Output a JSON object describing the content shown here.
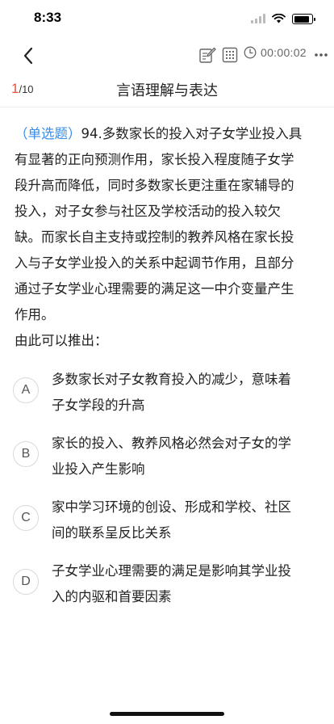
{
  "status_bar": {
    "time": "8:33"
  },
  "toolbar": {
    "timer": "00:00:02"
  },
  "subheader": {
    "progress_current": "1",
    "progress_total": "/10",
    "title": "言语理解与表达"
  },
  "question": {
    "type": "（单选题）",
    "lines": [
      "94.多数家长的投入对子女学业投入具",
      "有显著的正向预测作用，家长投入程度随子女学",
      "段升高而降低，同时多数家长更注重在家辅导的",
      "投入，对子女参与社区及学校活动的投入较欠",
      "缺。而家长自主支持或控制的教养风格在家长投",
      "入与子女学业投入的关系中起调节作用，且部分",
      "通过子女学业心理需要的满足这一中介变量产生",
      "作用。"
    ],
    "prompt": "由此可以推出："
  },
  "options": [
    {
      "letter": "A",
      "lines": [
        "多数家长对子女教育投入的减少，意味着",
        "子女学段的升高"
      ]
    },
    {
      "letter": "B",
      "lines": [
        "家长的投入、教养风格必然会对子女的学",
        "业投入产生影响"
      ]
    },
    {
      "letter": "C",
      "lines": [
        "家中学习环境的创设、形成和学校、社区",
        "间的联系呈反比关系"
      ]
    },
    {
      "letter": "D",
      "lines": [
        "子女学业心理需要的满足是影响其学业投",
        "入的内驱和首要因素"
      ]
    }
  ]
}
